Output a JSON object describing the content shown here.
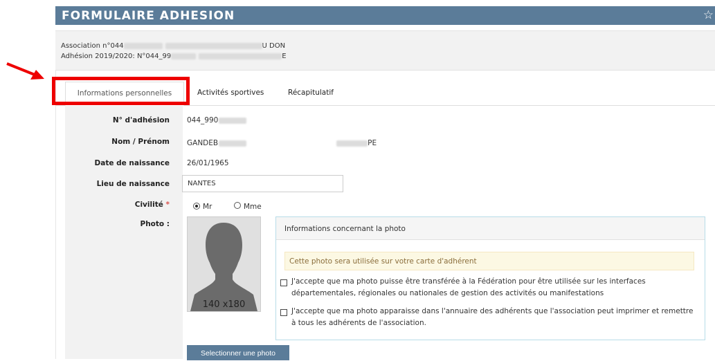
{
  "header": {
    "title": "FORMULAIRE ADHESION",
    "star_icon": "star-icon"
  },
  "info": {
    "association_prefix": "Association n°044",
    "association_suffix": "U DON",
    "adhesion_prefix": "Adhésion 2019/2020: N°044_99",
    "adhesion_suffix": "E"
  },
  "tabs": [
    {
      "label": "Informations personnelles",
      "active": true
    },
    {
      "label": "Activités sportives",
      "active": false
    },
    {
      "label": "Récapitulatif",
      "active": false
    }
  ],
  "form": {
    "num_adhesion": {
      "label": "N° d'adhésion",
      "value_visible": "044_990"
    },
    "nom_prenom": {
      "label": "Nom / Prénom",
      "nom_visible": "GANDEB",
      "prenom_visible": "PE"
    },
    "date_naissance": {
      "label": "Date de naissance",
      "value": "26/01/1965"
    },
    "lieu_naissance": {
      "label": "Lieu de naissance",
      "value": "NANTES"
    },
    "civilite": {
      "label": "Civilité",
      "required_mark": "*",
      "options": [
        {
          "label": "Mr",
          "checked": true
        },
        {
          "label": "Mme",
          "checked": false
        }
      ]
    },
    "photo": {
      "label": "Photo :",
      "placeholder_caption": "140 x180",
      "select_button": "Selectionner une photo"
    }
  },
  "photo_info": {
    "title": "Informations concernant la photo",
    "alert": "Cette photo sera utilisée sur votre carte d'adhérent",
    "consents": [
      {
        "text": "J'accepte que ma photo puisse être transférée à la Fédération pour être utilisée sur les interfaces départementales, régionales ou nationales de gestion des activités ou manifestations",
        "checked": false
      },
      {
        "text": "J'accepte que ma photo apparaisse dans l'annuaire des adhérents que l'association peut imprimer et remettre à tous les adhérents de l'association.",
        "checked": false
      }
    ]
  },
  "colors": {
    "header_bg": "#5b7c99",
    "highlight": "#ee0000",
    "alert_bg": "#fcf8e3"
  }
}
